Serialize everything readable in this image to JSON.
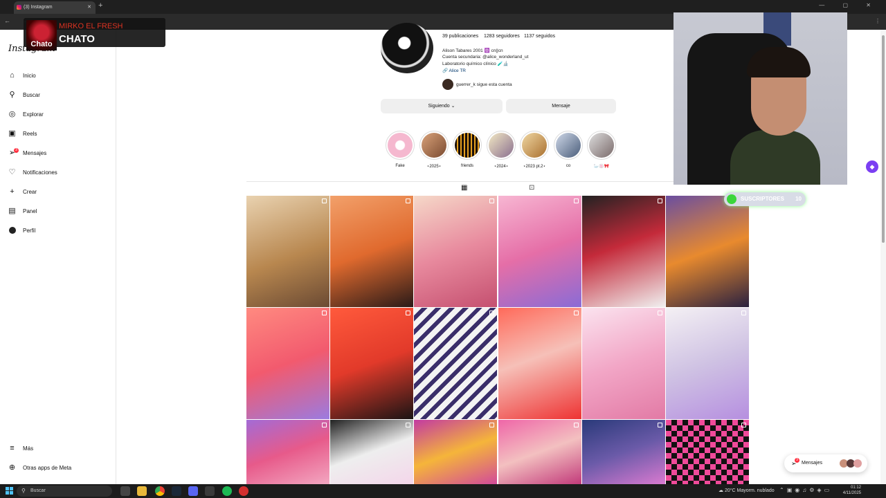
{
  "browser": {
    "tab_title": "(3) Instagram",
    "new_tab_symbol": "+",
    "window_controls": "— ▢ ✕"
  },
  "overlay_music": {
    "cover_text": "Chato",
    "artist": "Mirko El Fresh",
    "song": "CHATO"
  },
  "sidebar": {
    "logo": "Instagram",
    "items": [
      {
        "label": "Inicio"
      },
      {
        "label": "Buscar"
      },
      {
        "label": "Explorar"
      },
      {
        "label": "Reels"
      },
      {
        "label": "Mensajes",
        "badge": "3"
      },
      {
        "label": "Notificaciones"
      },
      {
        "label": "Crear"
      },
      {
        "label": "Panel"
      },
      {
        "label": "Perfil"
      }
    ],
    "more": "Más",
    "meta_apps": "Otras apps de Meta"
  },
  "profile": {
    "stats": {
      "posts": "39 publicaciones",
      "followers": "1283 seguidores",
      "following": "1137 seguidos"
    },
    "bio": [
      "Alison Tabares 2001 🔯 cn||cn",
      "Cuenta secundaria: @alice_wonderland_ut",
      "Laboratorio químico clínico 🧪🔬"
    ],
    "link": "🔗 Alice TR",
    "followed_by": "guerrer_k sigue esta cuenta",
    "follow_button": "Siguiendo ⌄",
    "message_button": "Mensaje"
  },
  "highlights": [
    {
      "label": "Fake"
    },
    {
      "label": "⋆2025⋆"
    },
    {
      "label": "friends"
    },
    {
      "label": "⋆2024⋆"
    },
    {
      "label": "⋆2023 pt.2⋆"
    },
    {
      "label": "co"
    },
    {
      "label": "🦢🍥🎀"
    }
  ],
  "overlay_subs": {
    "label": "SUSCRIPTORES",
    "count": "10"
  },
  "messages_pill": {
    "label": "Mensajes",
    "badge": "3"
  },
  "taskbar": {
    "search_placeholder": "Buscar",
    "weather": "20°C Mayorm. nublado",
    "time": "01:12",
    "date": "4/11/2025"
  }
}
